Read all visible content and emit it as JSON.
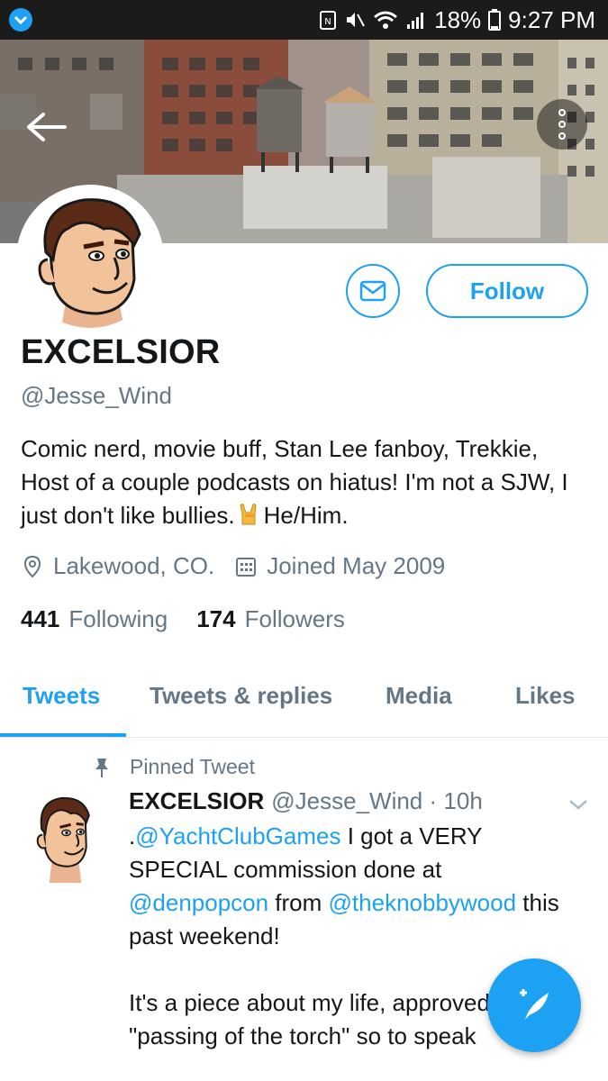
{
  "status_bar": {
    "battery": "18%",
    "time": "9:27 PM",
    "icons": [
      "twitter-notification-icon",
      "nfc-icon",
      "mute-icon",
      "wifi-icon",
      "signal-icon",
      "battery-icon"
    ]
  },
  "header": {
    "back_icon": "arrow-left-icon",
    "overflow_icon": "more-vertical-icon"
  },
  "profile": {
    "display_name": "EXCELSIOR",
    "handle": "@Jesse_Wind",
    "bio_part1": "Comic nerd, movie buff, Stan Lee fanboy, Trekkie, Host of a couple podcasts on hiatus! I'm not a SJW, I just don't like bullies.",
    "bio_part2": "He/Him.",
    "location": "Lakewood, CO.",
    "joined": "Joined May 2009",
    "following_count": "441",
    "following_label": "Following",
    "followers_count": "174",
    "followers_label": "Followers"
  },
  "actions": {
    "follow_label": "Follow",
    "dm_icon": "envelope-icon"
  },
  "tabs": [
    {
      "label": "Tweets",
      "active": true
    },
    {
      "label": "Tweets & replies",
      "active": false
    },
    {
      "label": "Media",
      "active": false
    },
    {
      "label": "Likes",
      "active": false
    }
  ],
  "pinned_tweet": {
    "pinned_label": "Pinned Tweet",
    "name": "EXCELSIOR",
    "handle": "@Jesse_Wind",
    "dot": "·",
    "time": "10h",
    "text_prefix": ".",
    "mention1": "@YachtClubGames",
    "text1": " I got a VERY SPECIAL commission done at ",
    "mention2": "@denpopcon",
    "text2": " from ",
    "mention3": "@theknobbywood",
    "text3": " this past weekend!",
    "text4": "It's a piece about my life, approved \"passing of the torch\" so to speak"
  },
  "compose_icon": "compose-tweet-icon",
  "colors": {
    "accent": "#1da1f2",
    "secondary_text": "#657786",
    "primary_text": "#14171a"
  }
}
